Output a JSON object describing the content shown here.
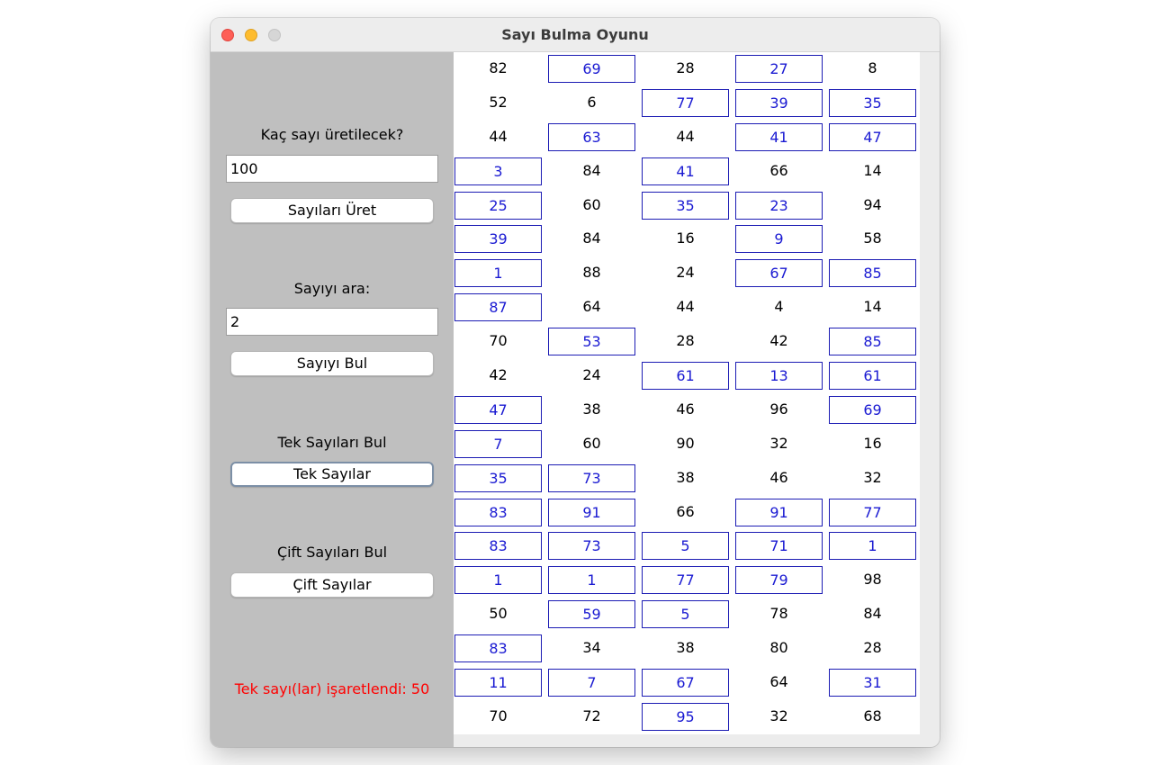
{
  "window": {
    "title": "Sayı Bulma Oyunu"
  },
  "controls": {
    "count_label": "Kaç sayı üretilecek?",
    "count_value": "100",
    "generate_button": "Sayıları Üret",
    "search_label": "Sayıyı ara:",
    "search_value": "2",
    "find_button": "Sayıyı Bul",
    "odd_label": "Tek Sayıları Bul",
    "odd_button": "Tek Sayılar",
    "even_label": "Çift Sayıları Bul",
    "even_button": "Çift Sayılar",
    "status_text": "Tek sayı(lar) işaretlendi: 50"
  },
  "colors": {
    "panel_bg": "#bfbfbf",
    "marked_border": "#1c1cb4",
    "marked_text": "#1a1ad2",
    "status_text": "#ff0000"
  },
  "numbers": [
    [
      82,
      69,
      28,
      27,
      8
    ],
    [
      52,
      6,
      77,
      39,
      35
    ],
    [
      44,
      63,
      44,
      41,
      47
    ],
    [
      3,
      84,
      41,
      66,
      14
    ],
    [
      25,
      60,
      35,
      23,
      94
    ],
    [
      39,
      84,
      16,
      9,
      58
    ],
    [
      1,
      88,
      24,
      67,
      85
    ],
    [
      87,
      64,
      44,
      4,
      14
    ],
    [
      70,
      53,
      28,
      42,
      85
    ],
    [
      42,
      24,
      61,
      13,
      61
    ],
    [
      47,
      38,
      46,
      96,
      69
    ],
    [
      7,
      60,
      90,
      32,
      16
    ],
    [
      35,
      73,
      38,
      46,
      32
    ],
    [
      83,
      91,
      66,
      91,
      77
    ],
    [
      83,
      73,
      5,
      71,
      1
    ],
    [
      1,
      1,
      77,
      79,
      98
    ],
    [
      50,
      59,
      5,
      78,
      84
    ],
    [
      83,
      34,
      38,
      80,
      28
    ],
    [
      11,
      7,
      67,
      64,
      31
    ],
    [
      70,
      72,
      95,
      32,
      68
    ]
  ]
}
